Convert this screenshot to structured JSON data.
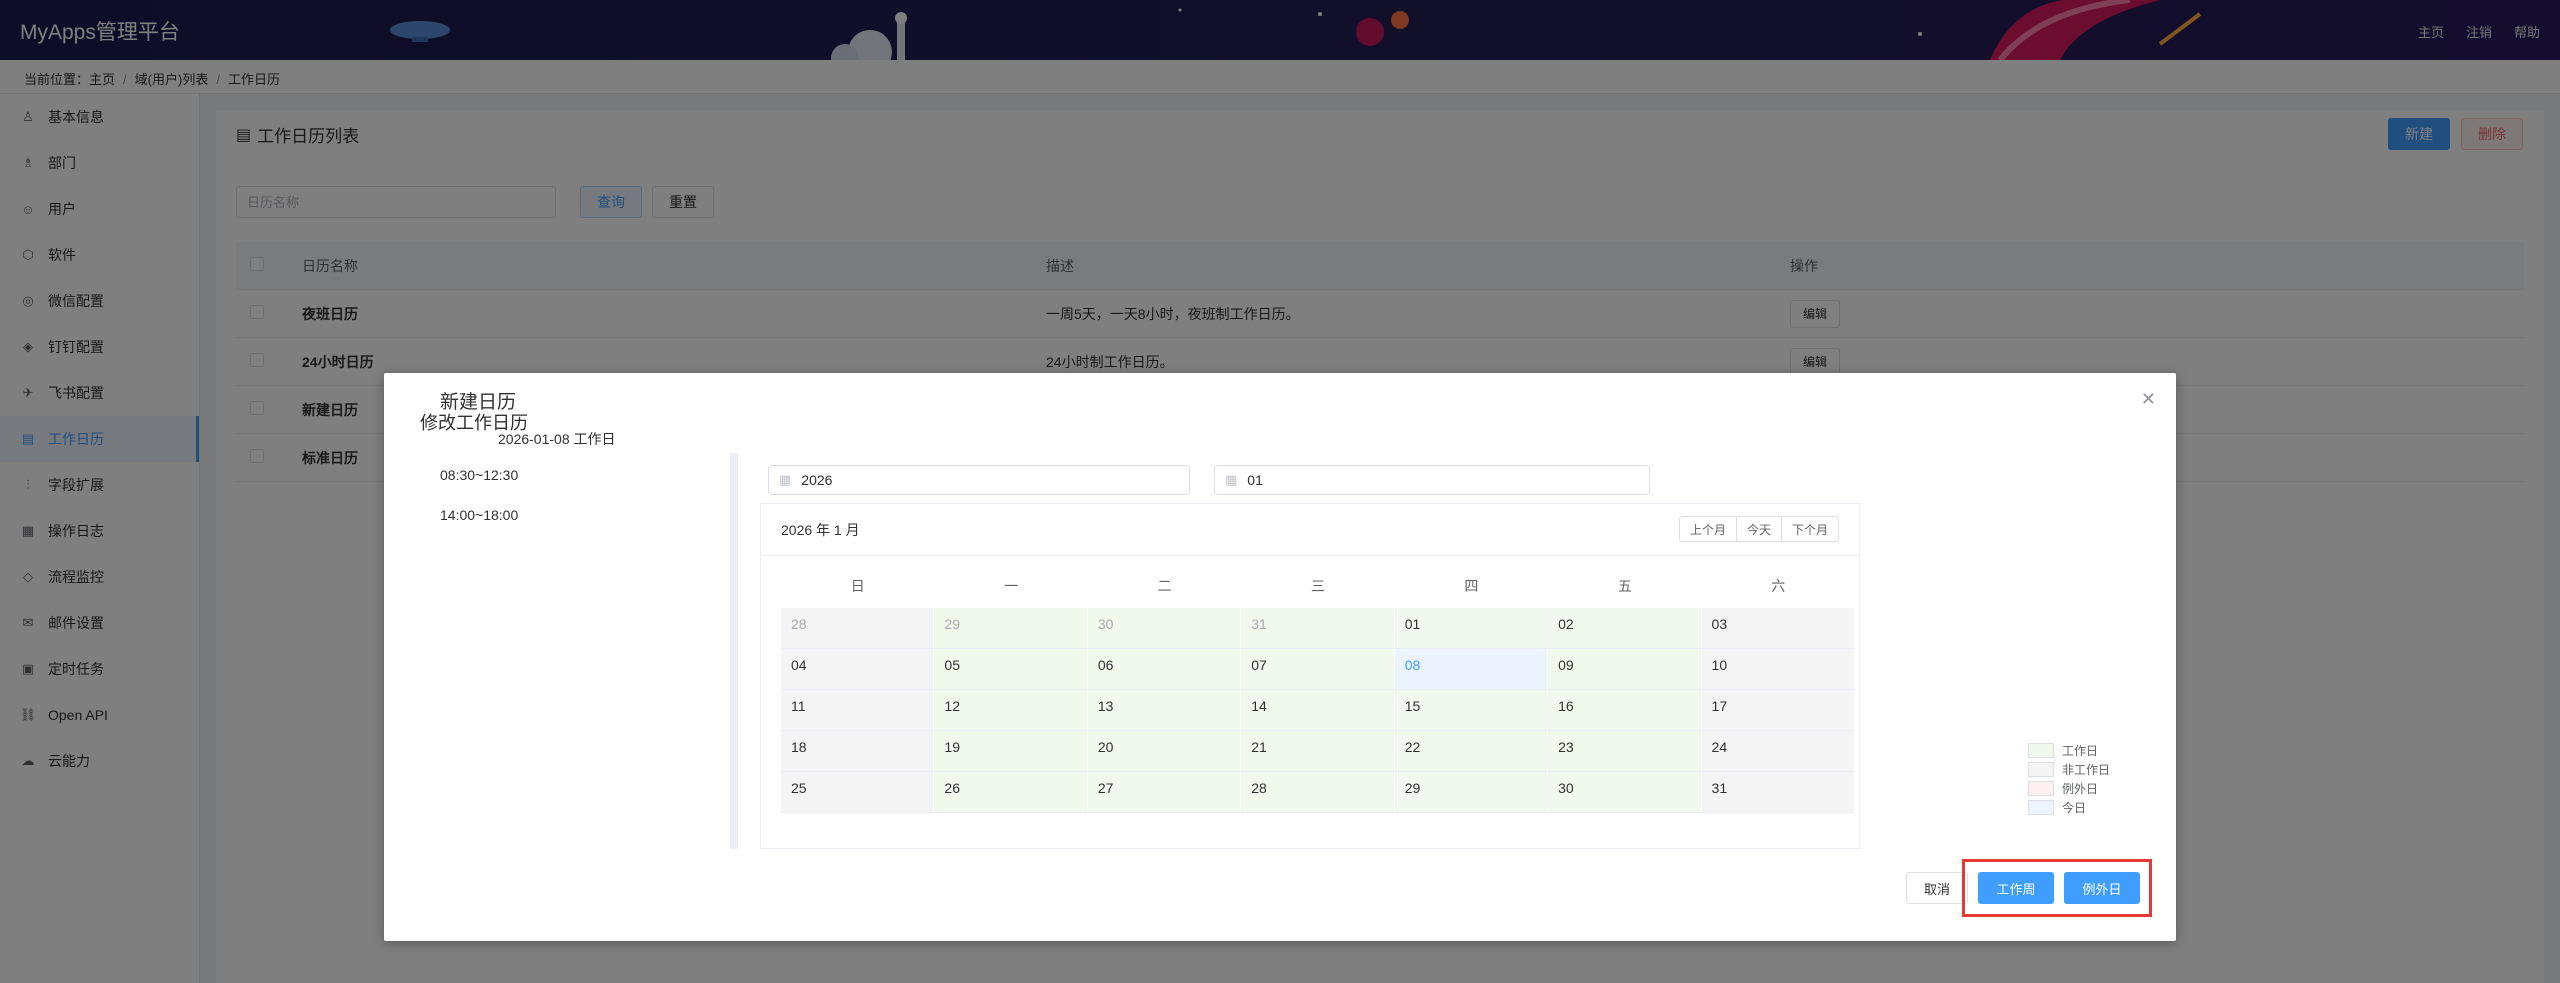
{
  "app": {
    "title": "MyApps管理平台"
  },
  "topmenu": [
    "主页",
    "注销",
    "帮助"
  ],
  "breadcrumb": {
    "label": "当前位置：",
    "items": [
      "主页",
      "域(用户)列表",
      "工作日历"
    ]
  },
  "sidebar": {
    "items": [
      {
        "label": "基本信息",
        "icon": "user-info-icon",
        "glyph": "♙"
      },
      {
        "label": "部门",
        "icon": "org-icon",
        "glyph": "♗"
      },
      {
        "label": "用户",
        "icon": "users-icon",
        "glyph": "☺"
      },
      {
        "label": "软件",
        "icon": "software-icon",
        "glyph": "⬡"
      },
      {
        "label": "微信配置",
        "icon": "wechat-icon",
        "glyph": "◎"
      },
      {
        "label": "钉钉配置",
        "icon": "dingtalk-icon",
        "glyph": "◈"
      },
      {
        "label": "飞书配置",
        "icon": "feishu-icon",
        "glyph": "✈"
      },
      {
        "label": "工作日历",
        "icon": "calendar-icon",
        "glyph": "▤",
        "active": true
      },
      {
        "label": "字段扩展",
        "icon": "field-extend-icon",
        "glyph": "⫶"
      },
      {
        "label": "操作日志",
        "icon": "log-icon",
        "glyph": "▦"
      },
      {
        "label": "流程监控",
        "icon": "monitor-icon",
        "glyph": "◇"
      },
      {
        "label": "邮件设置",
        "icon": "mail-icon",
        "glyph": "✉"
      },
      {
        "label": "定时任务",
        "icon": "timer-icon",
        "glyph": "▣"
      },
      {
        "label": "Open API",
        "icon": "link-icon",
        "glyph": "⛓"
      },
      {
        "label": "云能力",
        "icon": "cloud-icon",
        "glyph": "☁"
      }
    ]
  },
  "main": {
    "title": "工作日历列表",
    "new_label": "新建",
    "delete_label": "删除",
    "search_placeholder": "日历名称",
    "query_label": "查询",
    "reset_label": "重置",
    "table": {
      "headers": [
        "日历名称",
        "描述",
        "操作"
      ],
      "rows": [
        {
          "name": "夜班日历",
          "desc": "一周5天，一天8小时，夜班制工作日历。",
          "action": "编辑"
        },
        {
          "name": "24小时日历",
          "desc": "24小时制工作日历。",
          "action": "编辑"
        },
        {
          "name": "新建日历",
          "desc": "",
          "action": ""
        },
        {
          "name": "标准日历",
          "desc": "",
          "action": ""
        }
      ]
    }
  },
  "dialog": {
    "title": "修改工作日历",
    "calendar_name": "新建日历",
    "selected_date": "2026-01-08 工作日",
    "time1": "08:30~12:30",
    "time2": "14:00~18:00",
    "year": "2026",
    "month": "01",
    "ym_label": "2026 年 1 月",
    "prev_label": "上个月",
    "today_label": "今天",
    "next_label": "下个月",
    "weekdays": [
      "日",
      "一",
      "二",
      "三",
      "四",
      "五",
      "六"
    ],
    "weeks": [
      [
        {
          "d": "28",
          "t": "off",
          "o": true
        },
        {
          "d": "29",
          "t": "work",
          "o": true
        },
        {
          "d": "30",
          "t": "work",
          "o": true
        },
        {
          "d": "31",
          "t": "work",
          "o": true
        },
        {
          "d": "01",
          "t": "work"
        },
        {
          "d": "02",
          "t": "work"
        },
        {
          "d": "03",
          "t": "off"
        }
      ],
      [
        {
          "d": "04",
          "t": "off"
        },
        {
          "d": "05",
          "t": "work"
        },
        {
          "d": "06",
          "t": "work"
        },
        {
          "d": "07",
          "t": "work"
        },
        {
          "d": "08",
          "t": "today"
        },
        {
          "d": "09",
          "t": "work"
        },
        {
          "d": "10",
          "t": "off"
        }
      ],
      [
        {
          "d": "11",
          "t": "off"
        },
        {
          "d": "12",
          "t": "work"
        },
        {
          "d": "13",
          "t": "work"
        },
        {
          "d": "14",
          "t": "work"
        },
        {
          "d": "15",
          "t": "work"
        },
        {
          "d": "16",
          "t": "work"
        },
        {
          "d": "17",
          "t": "off"
        }
      ],
      [
        {
          "d": "18",
          "t": "off"
        },
        {
          "d": "19",
          "t": "work"
        },
        {
          "d": "20",
          "t": "work"
        },
        {
          "d": "21",
          "t": "work"
        },
        {
          "d": "22",
          "t": "work"
        },
        {
          "d": "23",
          "t": "work"
        },
        {
          "d": "24",
          "t": "off"
        }
      ],
      [
        {
          "d": "25",
          "t": "off"
        },
        {
          "d": "26",
          "t": "work"
        },
        {
          "d": "27",
          "t": "work"
        },
        {
          "d": "28",
          "t": "work"
        },
        {
          "d": "29",
          "t": "work"
        },
        {
          "d": "30",
          "t": "work"
        },
        {
          "d": "31",
          "t": "off"
        }
      ]
    ],
    "legend": [
      {
        "label": "工作日",
        "color": "#f0f9eb"
      },
      {
        "label": "非工作日",
        "color": "#f4f4f5"
      },
      {
        "label": "例外日",
        "color": "#fef0f0"
      },
      {
        "label": "今日",
        "color": "#ecf5ff"
      }
    ],
    "cancel_label": "取消",
    "workweek_label": "工作周",
    "exception_label": "例外日"
  }
}
